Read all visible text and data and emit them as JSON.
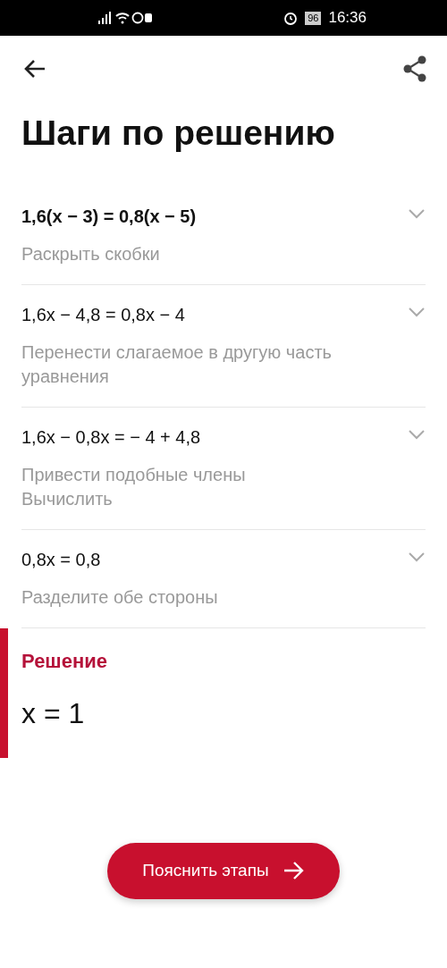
{
  "status_bar": {
    "battery": "96",
    "time": "16:36"
  },
  "title": "Шаги по решению",
  "steps": [
    {
      "equation": "1,6(x − 3) = 0,8(x − 5)",
      "bold": true,
      "hint": "Раскрыть скобки"
    },
    {
      "equation": "1,6x − 4,8 = 0,8x − 4",
      "bold": false,
      "hint": "Перенести слагаемое в другую часть уравнения"
    },
    {
      "equation": "1,6x − 0,8x = − 4 + 4,8",
      "bold": false,
      "hint": "Привести подобные члены\nВычислить"
    },
    {
      "equation": "0,8x = 0,8",
      "bold": false,
      "hint": "Разделите обе стороны"
    }
  ],
  "solution": {
    "label": "Решение",
    "answer": "x = 1"
  },
  "button": {
    "label": "Пояснить этапы"
  }
}
